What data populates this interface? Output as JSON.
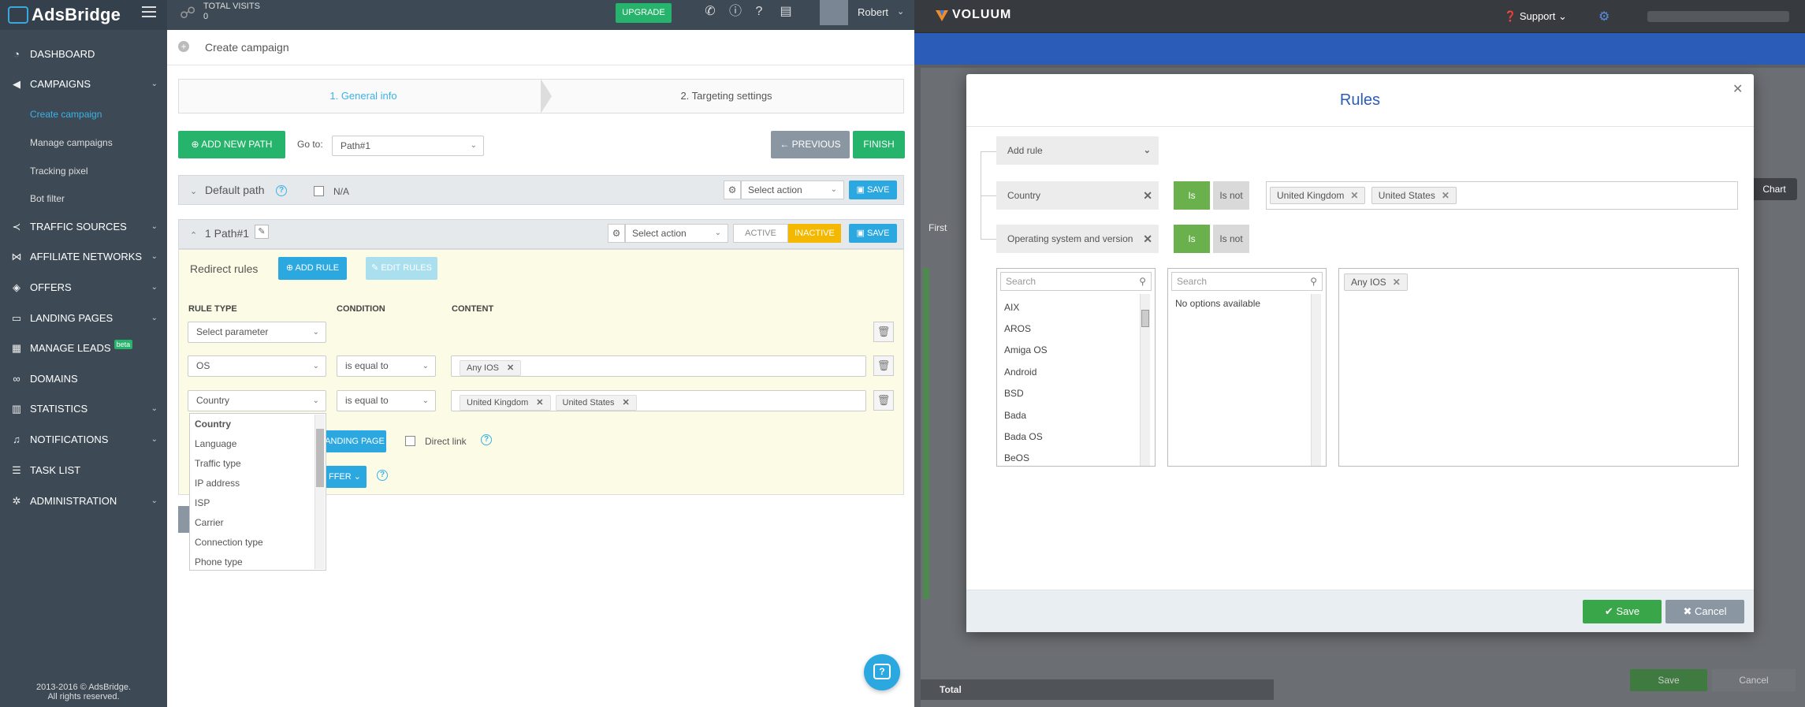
{
  "adsbridge": {
    "logo": "AdsBridge",
    "topbar": {
      "visits_label": "TOTAL VISITS",
      "visits_value": "0",
      "upgrade_label": "UPGRADE",
      "user_name": "Robert"
    },
    "sidebar": {
      "items": [
        {
          "label": "DASHBOARD"
        },
        {
          "label": "CAMPAIGNS"
        },
        {
          "label": "TRAFFIC SOURCES"
        },
        {
          "label": "AFFILIATE NETWORKS"
        },
        {
          "label": "OFFERS"
        },
        {
          "label": "LANDING PAGES"
        },
        {
          "label": "MANAGE LEADS",
          "badge": "beta"
        },
        {
          "label": "DOMAINS"
        },
        {
          "label": "STATISTICS"
        },
        {
          "label": "NOTIFICATIONS"
        },
        {
          "label": "TASK LIST"
        },
        {
          "label": "ADMINISTRATION"
        }
      ],
      "campaign_subitems": [
        {
          "label": "Create campaign"
        },
        {
          "label": "Manage campaigns"
        },
        {
          "label": "Tracking pixel"
        },
        {
          "label": "Bot filter"
        }
      ],
      "footer_line1": "2013-2016 © AdsBridge.",
      "footer_line2": "All rights reserved."
    },
    "page_title": "Create campaign",
    "steps": {
      "step1": "1. General info",
      "step2": "2. Targeting settings"
    },
    "toolbar": {
      "add_path": "ADD NEW PATH",
      "goto_label": "Go to:",
      "goto_value": "Path#1",
      "previous": "← PREVIOUS",
      "finish": "FINISH"
    },
    "default_path": {
      "name": "Default path",
      "na_label": "N/A",
      "action_placeholder": "Select action",
      "save": "SAVE"
    },
    "path1": {
      "name": "1 Path#1",
      "action_placeholder": "Select action",
      "active": "ACTIVE",
      "inactive": "INACTIVE",
      "save": "SAVE"
    },
    "redirect": {
      "title": "Redirect rules",
      "add_rule": "ADD RULE",
      "edit_rules": "EDIT RULES",
      "col_rule_type": "RULE TYPE",
      "col_condition": "CONDITION",
      "col_content": "CONTENT",
      "row1_type": "Select parameter",
      "row2_type": "OS",
      "row2_condition": "is equal to",
      "row2_tags": [
        "Any IOS"
      ],
      "row3_type": "Country",
      "row3_condition": "is equal to",
      "row3_tags": [
        "United Kingdom",
        "United States"
      ],
      "landing_page_btn": "ANDING PAGE",
      "direct_link": "Direct link",
      "offer_btn": "FFER"
    },
    "dropdown_options": [
      "Country",
      "Language",
      "Traffic type",
      "IP address",
      "ISP",
      "Carrier",
      "Connection type",
      "Phone type"
    ],
    "chat_icon": "?"
  },
  "voluum": {
    "logo": "VOLUUM",
    "support": "Support",
    "behind": {
      "chart_btn": "Chart",
      "first_label": "First",
      "total_label": "Total",
      "save": "Save",
      "cancel": "Cancel"
    },
    "modal": {
      "title": "Rules",
      "add_rule": "Add rule",
      "rules": [
        {
          "name": "Country",
          "is": "Is",
          "is_not": "Is not",
          "values": [
            "United Kingdom",
            "United States"
          ]
        },
        {
          "name": "Operating system and version",
          "is": "Is",
          "is_not": "Is not"
        }
      ],
      "search_placeholder": "Search",
      "os_list": [
        "AIX",
        "AROS",
        "Amiga OS",
        "Android",
        "BSD",
        "Bada",
        "Bada OS",
        "BeOS"
      ],
      "no_options": "No options available",
      "selected": [
        "Any IOS"
      ],
      "save": "Save",
      "cancel": "Cancel"
    }
  }
}
